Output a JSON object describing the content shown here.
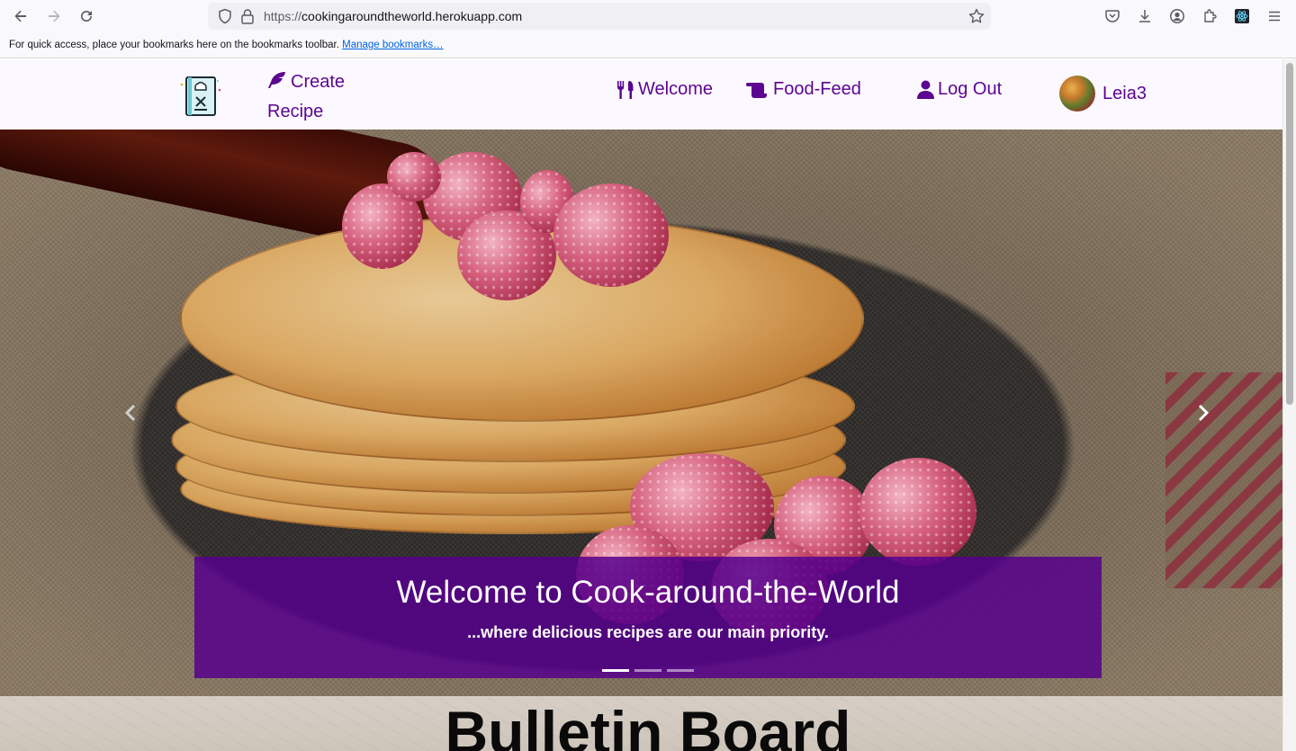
{
  "browser": {
    "url_protocol": "https://",
    "url_host": "cookingaroundtheworld.herokuapp.com",
    "bookmarks_hint": "For quick access, place your bookmarks here on the bookmarks toolbar.",
    "manage_bookmarks": "Manage bookmarks…",
    "icons": [
      "back-icon",
      "forward-icon",
      "reload-icon",
      "shield-icon",
      "lock-icon",
      "star-icon",
      "pocket-icon",
      "download-icon",
      "account-icon",
      "extensions-icon",
      "react-devtools-icon",
      "menu-icon"
    ]
  },
  "nav": {
    "create_recipe_line1": "Create",
    "create_recipe_line2": "Recipe",
    "welcome": "Welcome",
    "food_feed": "Food-Feed",
    "log_out": "Log Out",
    "username": "Leia3",
    "accent_color": "#5b0590"
  },
  "carousel": {
    "title": "Welcome to Cook-around-the-World",
    "subtitle": "...where delicious recipes are our main priority.",
    "slide_count": 3,
    "active_slide": 1,
    "caption_color": "#56008c"
  },
  "bulletin": {
    "title": "Bulletin Board"
  }
}
